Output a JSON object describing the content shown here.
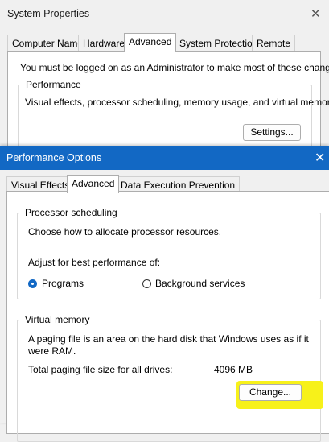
{
  "system_properties": {
    "title": "System Properties",
    "close_glyph": "✕",
    "tabs": [
      "Computer Name",
      "Hardware",
      "Advanced",
      "System Protection",
      "Remote"
    ],
    "active_tab": "Advanced",
    "admin_notice": "You must be logged on as an Administrator to make most of these changes.",
    "performance": {
      "legend": "Performance",
      "description": "Visual effects, processor scheduling, memory usage, and virtual memory",
      "settings_button": "Settings..."
    }
  },
  "performance_options": {
    "title": "Performance Options",
    "close_glyph": "✕",
    "title_bar_color": "#1268c4",
    "tabs": [
      "Visual Effects",
      "Advanced",
      "Data Execution Prevention"
    ],
    "active_tab": "Advanced",
    "processor_scheduling": {
      "legend": "Processor scheduling",
      "description": "Choose how to allocate processor resources.",
      "adjust_label": "Adjust for best performance of:",
      "options": [
        {
          "label": "Programs",
          "selected": true
        },
        {
          "label": "Background services",
          "selected": false
        }
      ]
    },
    "virtual_memory": {
      "legend": "Virtual memory",
      "description_line1": "A paging file is an area on the hard disk that Windows uses as if it",
      "description_line2": "were RAM.",
      "total_label": "Total paging file size for all drives:",
      "total_value": "4096 MB",
      "change_button": "Change...",
      "highlight_color": "#f7f11a"
    }
  }
}
